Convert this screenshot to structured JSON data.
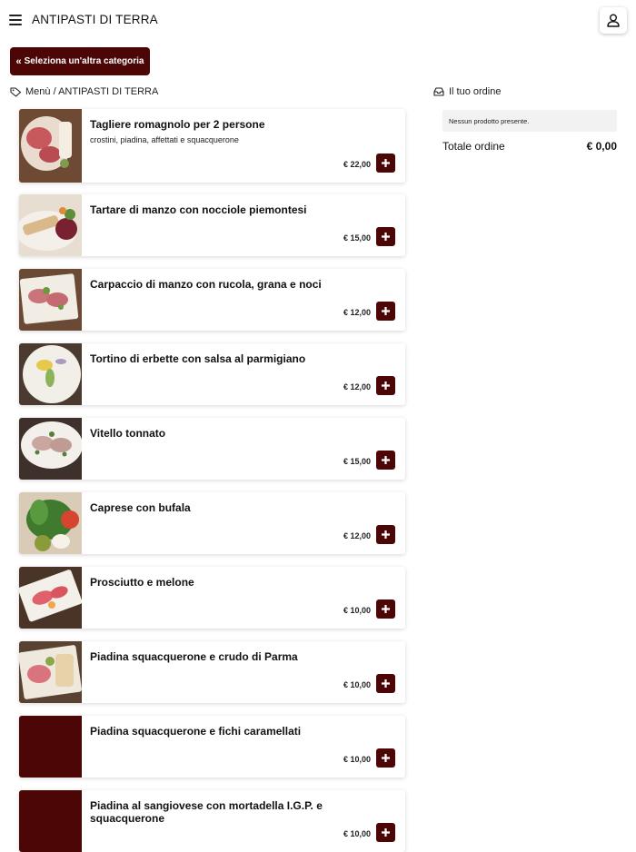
{
  "header": {
    "title": "ANTIPASTI DI TERRA",
    "menu_icon": "hamburger-icon",
    "user_icon": "user-icon"
  },
  "back_button": {
    "label": "Seleziona un'altra categoria",
    "icon": "double-chevron-left-icon"
  },
  "breadcrumb": {
    "text": "Menù / ANTIPASTI DI TERRA",
    "icon": "tag-icon"
  },
  "order": {
    "title": "Il tuo ordine",
    "icon": "inbox-tray-icon",
    "empty_text": "Nessun prodotto presente.",
    "total_label": "Totale ordine",
    "total_value": "€ 0,00"
  },
  "colors": {
    "accent": "#4d0606",
    "empty_box": "#f2f2f2"
  },
  "products": [
    {
      "name": "Tagliere romagnolo per 2 persone",
      "description": "crostini, piadina, affettati e squacquerone",
      "price": "€ 22,00"
    },
    {
      "name": "Tartare di manzo con nocciole piemontesi",
      "description": "",
      "price": "€ 15,00"
    },
    {
      "name": "Carpaccio di manzo con rucola, grana e noci",
      "description": "",
      "price": "€ 12,00"
    },
    {
      "name": "Tortino di erbette con salsa al parmigiano",
      "description": "",
      "price": "€ 12,00"
    },
    {
      "name": "Vitello tonnato",
      "description": "",
      "price": "€ 15,00"
    },
    {
      "name": "Caprese con bufala",
      "description": "",
      "price": "€ 12,00"
    },
    {
      "name": "Prosciutto e melone",
      "description": "",
      "price": "€ 10,00"
    },
    {
      "name": "Piadina squacquerone e crudo di Parma",
      "description": "",
      "price": "€ 10,00"
    },
    {
      "name": "Piadina squacquerone e fichi caramellati",
      "description": "",
      "price": "€ 10,00"
    },
    {
      "name": "Piadina al sangiovese con mortadella I.G.P. e squacquerone",
      "description": "",
      "price": "€ 10,00"
    }
  ]
}
